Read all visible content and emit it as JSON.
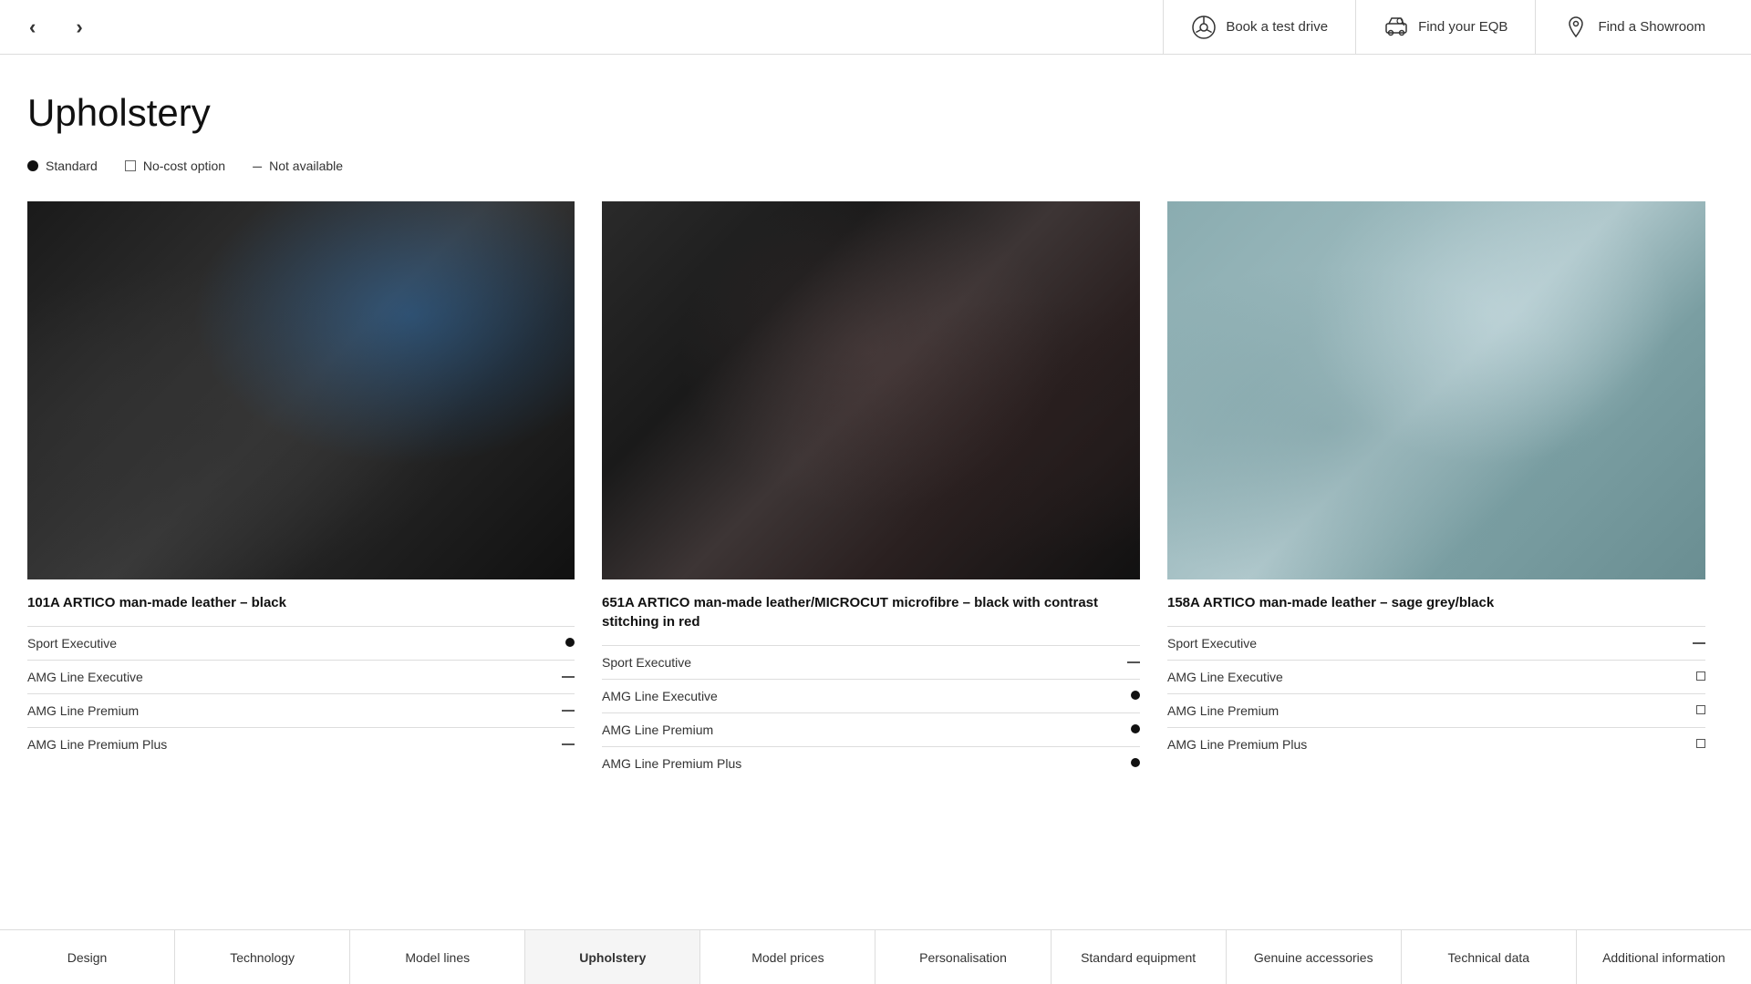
{
  "header": {
    "prev_arrow": "‹",
    "next_arrow": "›",
    "book_test_drive": "Book a test drive",
    "find_eqb": "Find your EQB",
    "find_showroom": "Find a Showroom"
  },
  "page": {
    "title": "Upholstery"
  },
  "legend": {
    "standard_label": "Standard",
    "no_cost_label": "No-cost option",
    "not_available_label": "Not available"
  },
  "cards": [
    {
      "id": "card-1",
      "image_type": "car-img-1",
      "title": "101A  ARTICO man-made leather – black",
      "specs": [
        {
          "label": "Sport Executive",
          "value": "dot"
        },
        {
          "label": "AMG Line Executive",
          "value": "dash"
        },
        {
          "label": "AMG Line Premium",
          "value": "dash"
        },
        {
          "label": "AMG Line Premium Plus",
          "value": "dash"
        }
      ]
    },
    {
      "id": "card-2",
      "image_type": "car-img-2",
      "title": "651A  ARTICO man-made leather/MICROCUT microfibre – black with contrast stitching in red",
      "specs": [
        {
          "label": "Sport Executive",
          "value": "dash"
        },
        {
          "label": "AMG Line Executive",
          "value": "dot"
        },
        {
          "label": "AMG Line Premium",
          "value": "dot"
        },
        {
          "label": "AMG Line Premium Plus",
          "value": "dot"
        }
      ]
    },
    {
      "id": "card-3",
      "image_type": "car-img-3",
      "title": "158A  ARTICO man-made leather – sage grey/black",
      "specs": [
        {
          "label": "Sport Executive",
          "value": "dash"
        },
        {
          "label": "AMG Line Executive",
          "value": "square"
        },
        {
          "label": "AMG Line Premium",
          "value": "square"
        },
        {
          "label": "AMG Line Premium Plus",
          "value": "square"
        }
      ]
    }
  ],
  "bottom_nav": [
    {
      "label": "Design",
      "active": false
    },
    {
      "label": "Technology",
      "active": false
    },
    {
      "label": "Model lines",
      "active": false
    },
    {
      "label": "Upholstery",
      "active": true
    },
    {
      "label": "Model prices",
      "active": false
    },
    {
      "label": "Personalisation",
      "active": false
    },
    {
      "label": "Standard equipment",
      "active": false
    },
    {
      "label": "Genuine accessories",
      "active": false
    },
    {
      "label": "Technical data",
      "active": false
    },
    {
      "label": "Additional information",
      "active": false
    }
  ]
}
